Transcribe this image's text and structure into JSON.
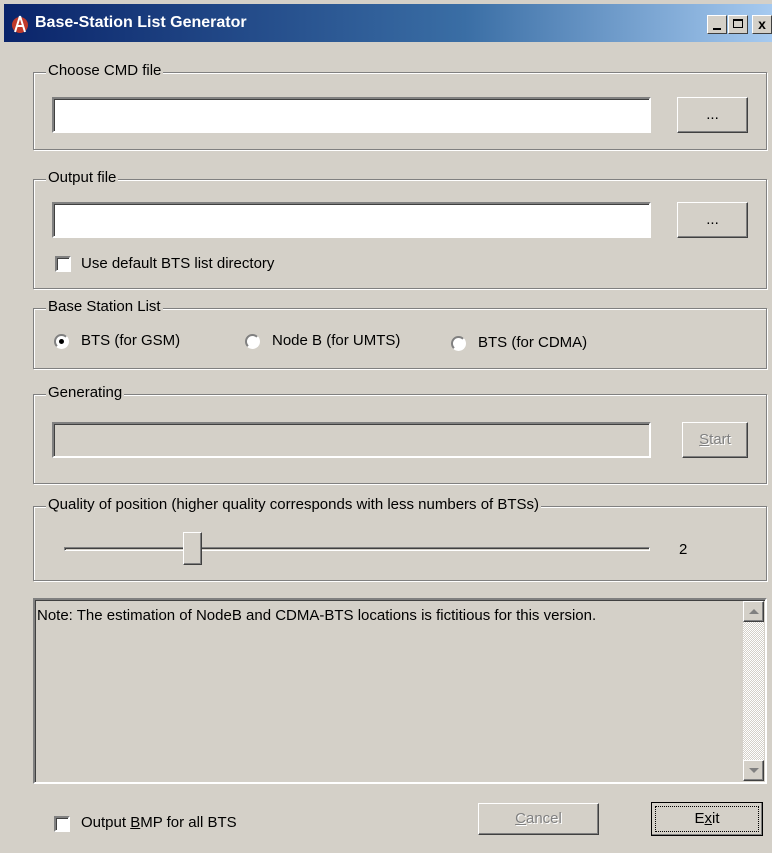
{
  "window": {
    "title": "Base-Station List Generator",
    "minimize_label": "_",
    "close_label": "x"
  },
  "cmd_group": {
    "label": "Choose CMD file",
    "value": "",
    "browse_label": "..."
  },
  "output_group": {
    "label": "Output file",
    "value": "",
    "browse_label": "...",
    "default_dir_label": "Use default BTS list directory",
    "default_dir_checked": false
  },
  "bs_list_group": {
    "label": "Base Station List",
    "options": [
      "BTS (for GSM)",
      "Node B (for UMTS)",
      "BTS (for CDMA)"
    ],
    "selected": "BTS (for GSM)"
  },
  "generating_group": {
    "label": "Generating",
    "progress": 0,
    "start_label_prefix": "",
    "start_label_accel": "S",
    "start_label_rest": "tart"
  },
  "quality_group": {
    "label": "Quality of position (higher quality corresponds with less numbers of BTSs)",
    "value": "2",
    "slider_fraction": 0.21
  },
  "note": {
    "text": "Note: The estimation of NodeB and CDMA-BTS locations is fictitious for this version."
  },
  "footer": {
    "bmp_label_prefix": "Output ",
    "bmp_label_accel": "B",
    "bmp_label_rest": "MP for all BTS",
    "bmp_checked": false,
    "cancel_label_accel": "C",
    "cancel_label_rest": "ancel",
    "exit_label_prefix": "E",
    "exit_label_accel": "x",
    "exit_label_rest": "it"
  },
  "colors": {
    "face": "#d4d0c8",
    "title_start": "#0a246a",
    "title_end": "#a6caf0"
  }
}
